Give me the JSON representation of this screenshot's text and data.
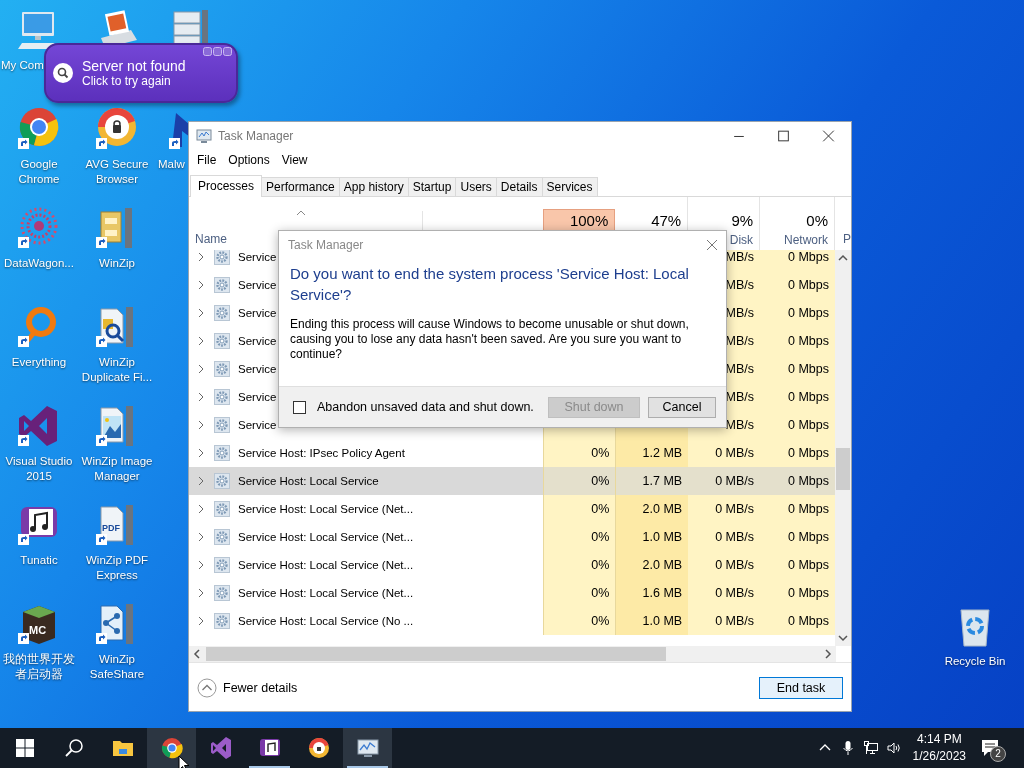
{
  "desktop_columns": [
    [
      {
        "kind": "computer",
        "label": "My Com",
        "shortcut": false
      },
      {
        "kind": "chrome",
        "label": "Google Chrome",
        "shortcut": true
      },
      {
        "kind": "datawagon",
        "label": "DataWagon...",
        "shortcut": true
      },
      {
        "kind": "everything",
        "label": "Everything",
        "shortcut": true
      },
      {
        "kind": "vs",
        "label": "Visual Studio 2015",
        "shortcut": true
      },
      {
        "kind": "tunatic",
        "label": "Tunatic",
        "shortcut": true
      },
      {
        "kind": "mc",
        "label": "我的世界开发者启动器",
        "icon_text": "MC",
        "shortcut": true
      }
    ],
    [
      {
        "kind": "scanner",
        "shortcut": false
      },
      {
        "kind": "avg",
        "label": "AVG Secure Browser",
        "shortcut": true
      },
      {
        "kind": "winzip",
        "label": "WinZip",
        "shortcut": true
      },
      {
        "kind": "winzipdup",
        "label": "WinZip Duplicate Fi...",
        "shortcut": true
      },
      {
        "kind": "winzipimage",
        "label": "WinZip Image Manager",
        "shortcut": true
      },
      {
        "kind": "winzippdf",
        "label": "WinZip PDF Express",
        "icon_text": "PDF",
        "shortcut": true
      },
      {
        "kind": "safeshare",
        "label": "WinZip SafeShare",
        "shortcut": true
      }
    ],
    [
      {
        "kind": "server",
        "shortcut": false
      },
      {
        "kind": "malware",
        "label": "Malw",
        "shortcut": true
      }
    ]
  ],
  "recycle_bin": {
    "label": "Recycle Bin"
  },
  "notification_bubble": {
    "title": "Server not found",
    "subtitle": "Click to try again"
  },
  "task_manager": {
    "title": "Task Manager",
    "menu": [
      "File",
      "Options",
      "View"
    ],
    "tabs": [
      {
        "label": "Processes",
        "selected": true
      },
      {
        "label": "Performance",
        "selected": false
      },
      {
        "label": "App history",
        "selected": false
      },
      {
        "label": "Startup",
        "selected": false
      },
      {
        "label": "Users",
        "selected": false
      },
      {
        "label": "Details",
        "selected": false
      },
      {
        "label": "Services",
        "selected": false
      }
    ],
    "columns": [
      {
        "kind": "name",
        "label": "Name"
      },
      {
        "kind": "cpu",
        "percent": "100%",
        "hot": true
      },
      {
        "kind": "memory",
        "percent": "47%",
        "hot": false
      },
      {
        "kind": "disk",
        "percent": "9%",
        "label": "Disk",
        "hot": false
      },
      {
        "kind": "network",
        "percent": "0%",
        "label": "Network",
        "hot": false
      },
      {
        "kind": "column_6",
        "label": "P"
      }
    ],
    "rows": [
      {
        "name": "Service",
        "disk": "MB/s",
        "network": "0 Mbps",
        "selected": false
      },
      {
        "name": "Service",
        "disk": "MB/s",
        "network": "0 Mbps",
        "selected": false
      },
      {
        "name": "Service",
        "disk": "MB/s",
        "network": "0 Mbps",
        "selected": false
      },
      {
        "name": "Service",
        "disk": "MB/s",
        "network": "0 Mbps",
        "selected": false
      },
      {
        "name": "Service",
        "disk": "MB/s",
        "network": "0 Mbps",
        "selected": false
      },
      {
        "name": "Service",
        "disk": "MB/s",
        "network": "0 Mbps",
        "selected": false
      },
      {
        "name": "Service",
        "disk": "MB/s",
        "network": "0 Mbps",
        "selected": false
      },
      {
        "name": "Service Host: IPsec Policy Agent",
        "cpu": "0%",
        "memory": "1.2 MB",
        "disk": "0 MB/s",
        "network": "0 Mbps",
        "selected": false
      },
      {
        "name": "Service Host: Local Service",
        "cpu": "0%",
        "memory": "1.7 MB",
        "disk": "0 MB/s",
        "network": "0 Mbps",
        "selected": true
      },
      {
        "name": "Service Host: Local Service (Net...",
        "cpu": "0%",
        "memory": "2.0 MB",
        "disk": "0 MB/s",
        "network": "0 Mbps",
        "selected": false
      },
      {
        "name": "Service Host: Local Service (Net...",
        "cpu": "0%",
        "memory": "1.0 MB",
        "disk": "0 MB/s",
        "network": "0 Mbps",
        "selected": false
      },
      {
        "name": "Service Host: Local Service (Net...",
        "cpu": "0%",
        "memory": "2.0 MB",
        "disk": "0 MB/s",
        "network": "0 Mbps",
        "selected": false
      },
      {
        "name": "Service Host: Local Service (Net...",
        "cpu": "0%",
        "memory": "1.6 MB",
        "disk": "0 MB/s",
        "network": "0 Mbps",
        "selected": false
      },
      {
        "name": "Service Host: Local Service (No ...",
        "cpu": "0%",
        "memory": "1.0 MB",
        "disk": "0 MB/s",
        "network": "0 Mbps",
        "selected": false
      }
    ],
    "footer": {
      "fewer_details": "Fewer details",
      "end_task": "End task"
    }
  },
  "dialog": {
    "title": "Task Manager",
    "heading": "Do you want to end the system process 'Service Host: Local Service'?",
    "body": "Ending this process will cause Windows to become unusable or shut down, causing you to lose any data hasn't been saved. Are you sure you want to continue?",
    "checkbox": {
      "label": "Abandon unsaved data and shut down.",
      "checked": false
    },
    "buttons": [
      {
        "label": "Shut down",
        "disabled": true
      },
      {
        "label": "Cancel",
        "disabled": false
      }
    ]
  },
  "taskbar": {
    "items": [
      {
        "kind": "start",
        "highlighted": false,
        "running": false
      },
      {
        "kind": "search",
        "highlighted": false,
        "running": false
      },
      {
        "kind": "explorer",
        "highlighted": false,
        "running": false
      },
      {
        "kind": "chrome",
        "highlighted": true,
        "running": false
      },
      {
        "kind": "vs",
        "highlighted": false,
        "running": false
      },
      {
        "kind": "tunatic",
        "highlighted": false,
        "running": true
      },
      {
        "kind": "avg",
        "highlighted": false,
        "running": false
      },
      {
        "kind": "taskmgr",
        "highlighted": true,
        "running": true
      }
    ],
    "time": "4:14 PM",
    "date": "1/26/2023",
    "notification_count": "2"
  }
}
